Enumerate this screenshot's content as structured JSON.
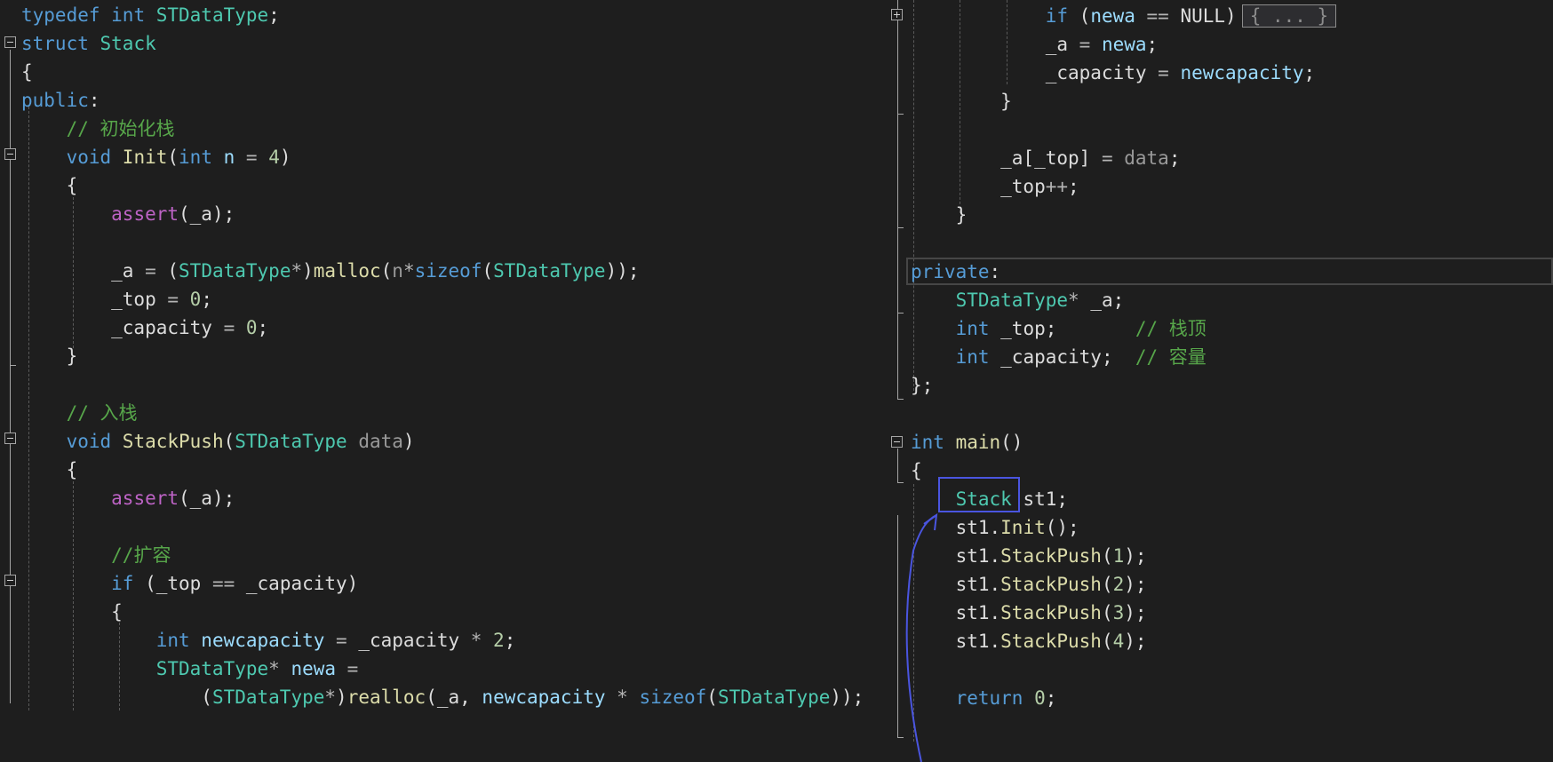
{
  "editor": {
    "left_lines": [
      [
        [
          "kw",
          "typedef "
        ],
        [
          "kw",
          "int "
        ],
        [
          "ty",
          "STDataType"
        ],
        [
          "pl",
          ";"
        ]
      ],
      [
        [
          "kw",
          "struct "
        ],
        [
          "ty",
          "Stack"
        ]
      ],
      [
        [
          "pl",
          "{"
        ]
      ],
      [
        [
          "kw",
          "public"
        ],
        [
          "pl",
          ":"
        ]
      ],
      [
        [
          "pl",
          "    "
        ],
        [
          "cm",
          "// 初始化栈"
        ]
      ],
      [
        [
          "pl",
          "    "
        ],
        [
          "kw",
          "void "
        ],
        [
          "fn",
          "Init"
        ],
        [
          "pl",
          "("
        ],
        [
          "kw",
          "int "
        ],
        [
          "pa",
          "n"
        ],
        [
          "op",
          " = "
        ],
        [
          "nu",
          "4"
        ],
        [
          "pl",
          ")"
        ]
      ],
      [
        [
          "pl",
          "    {"
        ]
      ],
      [
        [
          "pl",
          "        "
        ],
        [
          "mc",
          "assert"
        ],
        [
          "pl",
          "(_a);"
        ]
      ],
      [
        [
          "pl",
          ""
        ]
      ],
      [
        [
          "pl",
          "        _a "
        ],
        [
          "op",
          "= "
        ],
        [
          "pl",
          "("
        ],
        [
          "ty",
          "STDataType"
        ],
        [
          "op",
          "*"
        ],
        [
          "pl",
          ")"
        ],
        [
          "fn",
          "malloc"
        ],
        [
          "pl",
          "("
        ],
        [
          "pv",
          "n"
        ],
        [
          "op",
          "*"
        ],
        [
          "kw",
          "sizeof"
        ],
        [
          "pl",
          "("
        ],
        [
          "ty",
          "STDataType"
        ],
        [
          "pl",
          "));"
        ]
      ],
      [
        [
          "pl",
          "        _top "
        ],
        [
          "op",
          "= "
        ],
        [
          "nu",
          "0"
        ],
        [
          "pl",
          ";"
        ]
      ],
      [
        [
          "pl",
          "        _capacity "
        ],
        [
          "op",
          "= "
        ],
        [
          "nu",
          "0"
        ],
        [
          "pl",
          ";"
        ]
      ],
      [
        [
          "pl",
          "    }"
        ]
      ],
      [
        [
          "pl",
          ""
        ]
      ],
      [
        [
          "pl",
          "    "
        ],
        [
          "cm",
          "// 入栈"
        ]
      ],
      [
        [
          "pl",
          "    "
        ],
        [
          "kw",
          "void "
        ],
        [
          "fn",
          "StackPush"
        ],
        [
          "pl",
          "("
        ],
        [
          "ty",
          "STDataType "
        ],
        [
          "pv",
          "data"
        ],
        [
          "pl",
          ")"
        ]
      ],
      [
        [
          "pl",
          "    {"
        ]
      ],
      [
        [
          "pl",
          "        "
        ],
        [
          "mc",
          "assert"
        ],
        [
          "pl",
          "(_a);"
        ]
      ],
      [
        [
          "pl",
          ""
        ]
      ],
      [
        [
          "pl",
          "        "
        ],
        [
          "cm",
          "//扩容"
        ]
      ],
      [
        [
          "pl",
          "        "
        ],
        [
          "kw",
          "if "
        ],
        [
          "pl",
          "(_top "
        ],
        [
          "op",
          "== "
        ],
        [
          "pl",
          "_capacity)"
        ]
      ],
      [
        [
          "pl",
          "        {"
        ]
      ],
      [
        [
          "pl",
          "            "
        ],
        [
          "kw",
          "int "
        ],
        [
          "pa",
          "newcapacity "
        ],
        [
          "op",
          "= "
        ],
        [
          "pl",
          "_capacity "
        ],
        [
          "op",
          "* "
        ],
        [
          "nu",
          "2"
        ],
        [
          "pl",
          ";"
        ]
      ],
      [
        [
          "pl",
          "            "
        ],
        [
          "ty",
          "STDataType"
        ],
        [
          "op",
          "* "
        ],
        [
          "pa",
          "newa "
        ],
        [
          "op",
          "="
        ]
      ],
      [
        [
          "pl",
          "                ("
        ],
        [
          "ty",
          "STDataType"
        ],
        [
          "op",
          "*"
        ],
        [
          "pl",
          ")"
        ],
        [
          "fn",
          "realloc"
        ],
        [
          "pl",
          "(_a, "
        ],
        [
          "pa",
          "newcapacity "
        ],
        [
          "op",
          "* "
        ],
        [
          "kw",
          "sizeof"
        ],
        [
          "pl",
          "("
        ],
        [
          "ty",
          "STDataType"
        ],
        [
          "pl",
          "));"
        ]
      ]
    ],
    "right_lines": [
      [
        [
          "pl",
          "            "
        ],
        [
          "kw",
          "if "
        ],
        [
          "pl",
          "("
        ],
        [
          "pa",
          "newa "
        ],
        [
          "op",
          "== "
        ],
        [
          "pl",
          "NULL)"
        ]
      ],
      [
        [
          "pl",
          "            _a "
        ],
        [
          "op",
          "= "
        ],
        [
          "pa",
          "newa"
        ],
        [
          "pl",
          ";"
        ]
      ],
      [
        [
          "pl",
          "            _capacity "
        ],
        [
          "op",
          "= "
        ],
        [
          "pa",
          "newcapacity"
        ],
        [
          "pl",
          ";"
        ]
      ],
      [
        [
          "pl",
          "        }"
        ]
      ],
      [
        [
          "pl",
          ""
        ]
      ],
      [
        [
          "pl",
          "        _a[_top] "
        ],
        [
          "op",
          "= "
        ],
        [
          "pv",
          "data"
        ],
        [
          "pl",
          ";"
        ]
      ],
      [
        [
          "pl",
          "        _top"
        ],
        [
          "op",
          "++"
        ],
        [
          "pl",
          ";"
        ]
      ],
      [
        [
          "pl",
          "    }"
        ]
      ],
      [
        [
          "pl",
          ""
        ]
      ],
      [
        [
          "kw",
          "private"
        ],
        [
          "pl",
          ":"
        ]
      ],
      [
        [
          "pl",
          "    "
        ],
        [
          "ty",
          "STDataType"
        ],
        [
          "op",
          "* "
        ],
        [
          "pl",
          "_a;"
        ]
      ],
      [
        [
          "pl",
          "    "
        ],
        [
          "kw",
          "int "
        ],
        [
          "pl",
          "_top;       "
        ],
        [
          "cm",
          "// 栈顶"
        ]
      ],
      [
        [
          "pl",
          "    "
        ],
        [
          "kw",
          "int "
        ],
        [
          "pl",
          "_capacity;  "
        ],
        [
          "cm",
          "// 容量"
        ]
      ],
      [
        [
          "pl",
          "};"
        ]
      ],
      [
        [
          "pl",
          ""
        ]
      ],
      [
        [
          "kw",
          "int "
        ],
        [
          "fn",
          "main"
        ],
        [
          "pl",
          "()"
        ]
      ],
      [
        [
          "pl",
          "{"
        ]
      ],
      [
        [
          "pl",
          "    "
        ],
        [
          "ty",
          "Stack "
        ],
        [
          "pl",
          "st1;"
        ]
      ],
      [
        [
          "pl",
          "    st1."
        ],
        [
          "fn",
          "Init"
        ],
        [
          "pl",
          "();"
        ]
      ],
      [
        [
          "pl",
          "    st1."
        ],
        [
          "fn",
          "StackPush"
        ],
        [
          "pl",
          "("
        ],
        [
          "nu",
          "1"
        ],
        [
          "pl",
          ");"
        ]
      ],
      [
        [
          "pl",
          "    st1."
        ],
        [
          "fn",
          "StackPush"
        ],
        [
          "pl",
          "("
        ],
        [
          "nu",
          "2"
        ],
        [
          "pl",
          ");"
        ]
      ],
      [
        [
          "pl",
          "    st1."
        ],
        [
          "fn",
          "StackPush"
        ],
        [
          "pl",
          "("
        ],
        [
          "nu",
          "3"
        ],
        [
          "pl",
          ");"
        ]
      ],
      [
        [
          "pl",
          "    st1."
        ],
        [
          "fn",
          "StackPush"
        ],
        [
          "pl",
          "("
        ],
        [
          "nu",
          "4"
        ],
        [
          "pl",
          ");"
        ]
      ],
      [
        [
          "pl",
          ""
        ]
      ],
      [
        [
          "pl",
          "    "
        ],
        [
          "kw",
          "return "
        ],
        [
          "nu",
          "0"
        ],
        [
          "pl",
          ";"
        ]
      ]
    ],
    "collapsed_label": "{ ... }",
    "colors": {
      "background": "#1e1e1e",
      "keyword": "#569cd6",
      "type": "#4ec9b0",
      "function": "#dcdcaa",
      "comment": "#57a64a",
      "macro": "#bd63c5",
      "annotation": "#4a55e0"
    }
  }
}
